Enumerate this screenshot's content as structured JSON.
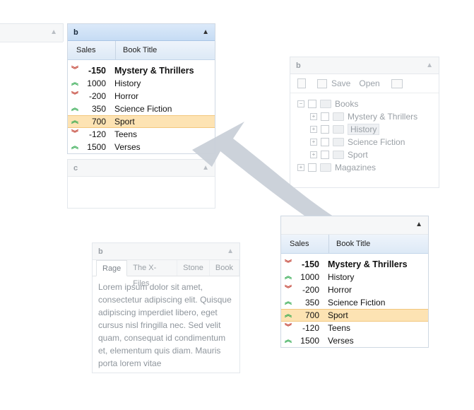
{
  "grid_headers": {
    "sales": "Sales",
    "title": "Book Title"
  },
  "grid_rows": [
    {
      "trend": "down",
      "sales": "-150",
      "title": "Mystery & Thrillers",
      "bold": true
    },
    {
      "trend": "up",
      "sales": "1000",
      "title": "History"
    },
    {
      "trend": "down",
      "sales": "-200",
      "title": "Horror"
    },
    {
      "trend": "up",
      "sales": "350",
      "title": "Science Fiction"
    },
    {
      "trend": "up",
      "sales": "700",
      "title": "Sport",
      "selected": true
    },
    {
      "trend": "down",
      "sales": "-120",
      "title": "Teens"
    },
    {
      "trend": "up",
      "sales": "1500",
      "title": "Verses"
    }
  ],
  "panel_b_title": "b",
  "panel_c_title": "c",
  "tree_panel": {
    "title": "b",
    "toolbar": {
      "save": "Save",
      "open": "Open"
    },
    "nodes": {
      "books": "Books",
      "mystery": "Mystery & Thrillers",
      "history": "History",
      "scifi": "Science Fiction",
      "sport": "Sport",
      "magazines": "Magazines"
    }
  },
  "tab_panel": {
    "title": "b",
    "tabs": {
      "t1": "Rage",
      "t2": "The X-Files",
      "t3": "Stone",
      "t4": "Book"
    },
    "text": "Lorem ipsum dolor sit amet, consectetur adipiscing elit. Quisque adipiscing imperdiet libero, eget cursus nisl fringilla nec. Sed velit quam, consequat id condimentum et, elementum quis diam. Mauris porta lorem vitae"
  },
  "icons": {
    "up": "arrow-up-icon",
    "down": "arrow-down-icon",
    "collapse": "chevron-up-icon"
  },
  "colors": {
    "selected_row": "#fde3b3",
    "up": "#2ea84d",
    "down": "#c0392b",
    "header": "#c6dcf4"
  }
}
